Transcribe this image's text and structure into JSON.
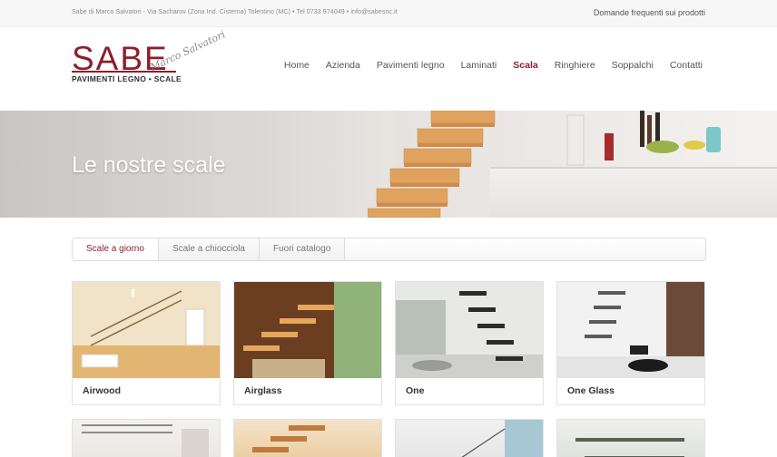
{
  "topbar": {
    "info": "Sabe di Marco Salvatori - Via Sacharov (Zona Ind. Cisterna) Tolentino (MC) • Tel 0733 974049 • info@sabesnc.it",
    "faq_link": "Domande frequenti sui prodotti"
  },
  "logo": {
    "brand": "SABE",
    "tagline": "PAVIMENTI LEGNO • SCALE",
    "signature": "Marco Salvatori"
  },
  "nav": {
    "items": [
      "Home",
      "Azienda",
      "Pavimenti legno",
      "Laminati",
      "Scala",
      "Ringhiere",
      "Soppalchi",
      "Contatti"
    ],
    "active_index": 4
  },
  "hero": {
    "title": "Le nostre scale"
  },
  "tabs": {
    "items": [
      "Scale a giorno",
      "Scale a chiocciola",
      "Fuori catalogo"
    ],
    "active_index": 0
  },
  "products": [
    "Airwood",
    "Airglass",
    "One",
    "One Glass"
  ],
  "colors": {
    "accent": "#8c1f2c",
    "text": "#333333",
    "muted": "#8a8a8a"
  }
}
